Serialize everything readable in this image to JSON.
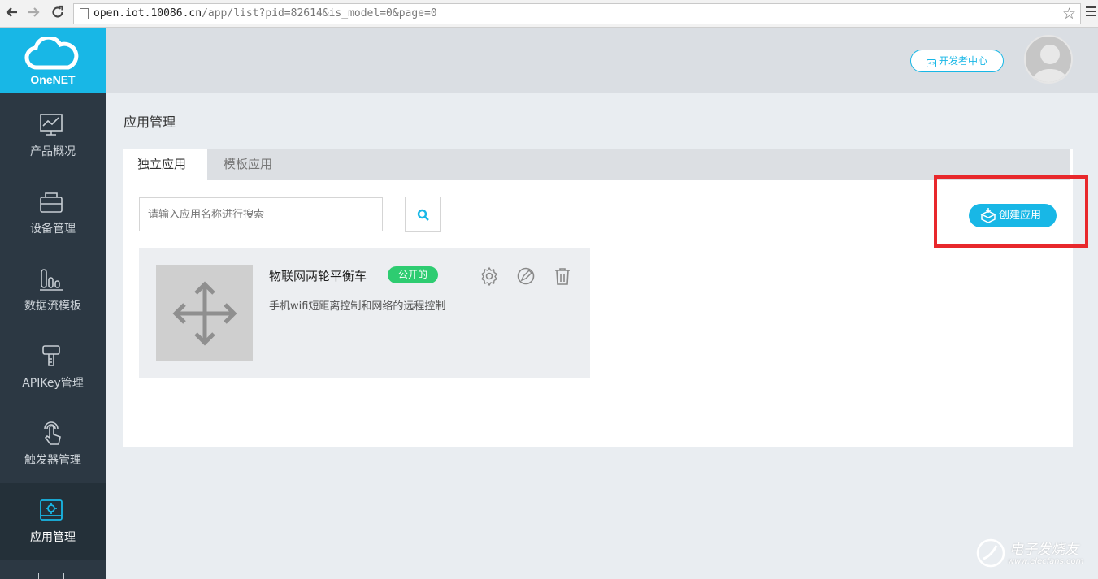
{
  "browser": {
    "url_host": "open.iot.10086.cn",
    "url_path": "/app/list?pid=82614&is_model=0&page=0",
    "back_icon": "arrow-left-icon",
    "forward_icon": "arrow-right-icon",
    "reload_icon": "reload-icon",
    "star_icon": "star-icon",
    "menu_icon": "hamburger-icon"
  },
  "sidebar": {
    "logo_text": "OneNET",
    "items": [
      {
        "label": "产品概况",
        "icon": "chart-monitor-icon"
      },
      {
        "label": "设备管理",
        "icon": "device-box-icon"
      },
      {
        "label": "数据流模板",
        "icon": "bar-columns-icon"
      },
      {
        "label": "APIKey管理",
        "icon": "key-icon"
      },
      {
        "label": "触发器管理",
        "icon": "touch-hand-icon"
      },
      {
        "label": "应用管理",
        "icon": "app-gear-icon",
        "active": true
      }
    ]
  },
  "header": {
    "dev_center_label": "开发者中心"
  },
  "main": {
    "page_title": "应用管理",
    "tabs": [
      {
        "label": "独立应用",
        "active": true
      },
      {
        "label": "模板应用",
        "active": false
      }
    ],
    "search": {
      "placeholder": "请输入应用名称进行搜索",
      "value": ""
    },
    "create_button_label": "创建应用",
    "apps": [
      {
        "name": "物联网两轮平衡车",
        "badge": "公开的",
        "description": "手机wifi短距离控制和网络的远程控制"
      }
    ]
  },
  "watermark": {
    "text": "电子发烧友",
    "url": "www.elecfans.com"
  },
  "colors": {
    "brand": "#18b7e6",
    "sidebar_bg": "#2c3843",
    "badge_green": "#2ecc71",
    "highlight_red": "#e8282c"
  }
}
